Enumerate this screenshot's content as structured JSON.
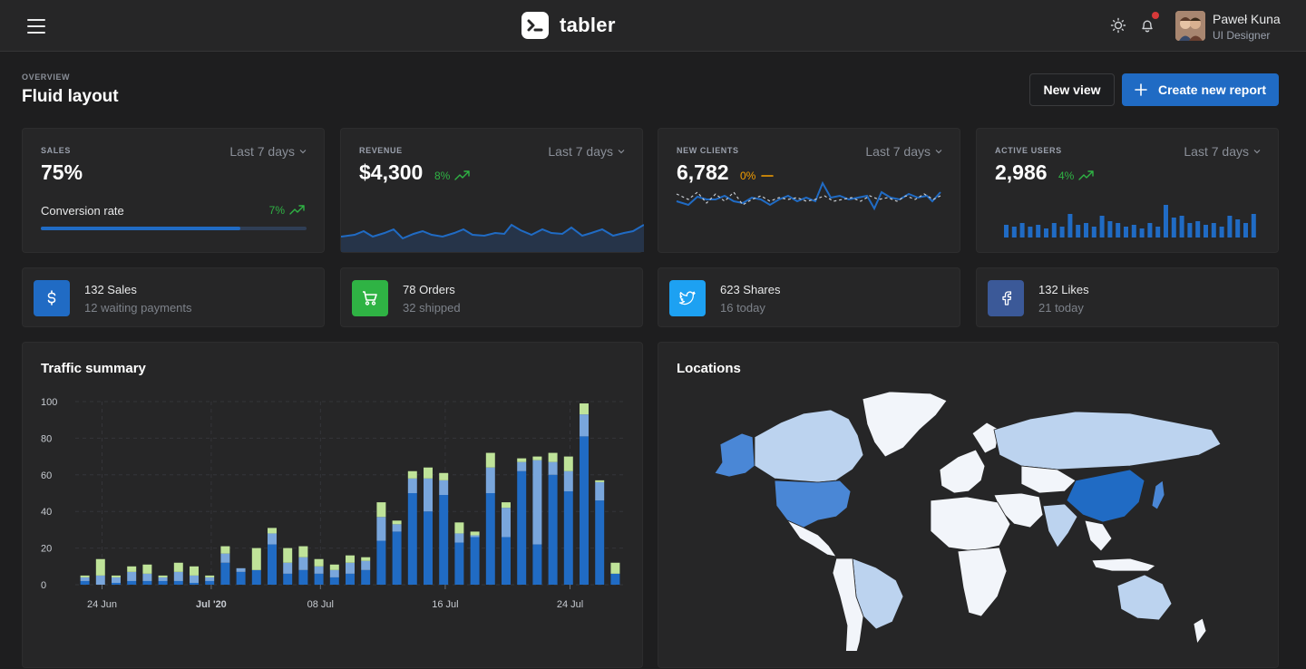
{
  "header": {
    "brand": "tabler",
    "user_name": "Paweł Kuna",
    "user_role": "UI Designer"
  },
  "page": {
    "pretitle": "OVERVIEW",
    "title": "Fluid layout",
    "new_view_label": "New view",
    "create_report_label": "Create new report"
  },
  "stats": [
    {
      "subheader": "SALES",
      "range": "Last 7 days",
      "value": "75%",
      "footer_label": "Conversion rate",
      "trend": "7%",
      "progress": 0.75
    },
    {
      "subheader": "REVENUE",
      "range": "Last 7 days",
      "value": "$4,300",
      "trend": "8%"
    },
    {
      "subheader": "NEW CLIENTS",
      "range": "Last 7 days",
      "value": "6,782",
      "trend": "0%"
    },
    {
      "subheader": "ACTIVE USERS",
      "range": "Last 7 days",
      "value": "2,986",
      "trend": "4%"
    }
  ],
  "mini_cards": [
    {
      "icon": "dollar-icon",
      "color": "#206bc4",
      "title": "132 Sales",
      "subtitle": "12 waiting payments"
    },
    {
      "icon": "cart-icon",
      "color": "#2fb344",
      "title": "78 Orders",
      "subtitle": "32 shipped"
    },
    {
      "icon": "twitter-icon",
      "color": "#1da1f2",
      "title": "623 Shares",
      "subtitle": "16 today"
    },
    {
      "icon": "facebook-icon",
      "color": "#3b5998",
      "title": "132 Likes",
      "subtitle": "21 today"
    }
  ],
  "traffic": {
    "title": "Traffic summary"
  },
  "locations": {
    "title": "Locations"
  },
  "colors": {
    "primary": "#206bc4",
    "success": "#2fb344",
    "warning": "#f59f00",
    "danger": "#d63939"
  },
  "chart_data": {
    "type": "bar",
    "title": "Traffic summary",
    "stacked": true,
    "ylim": [
      0,
      100
    ],
    "yticks": [
      0,
      20,
      40,
      60,
      80,
      100
    ],
    "xtick_labels": [
      "24 Jun",
      "Jul '20",
      "08 Jul",
      "16 Jul",
      "24 Jul"
    ],
    "series": [
      {
        "color": "#206bc4",
        "values": [
          2,
          0,
          1,
          2,
          2,
          2,
          2,
          1,
          2,
          12,
          7,
          8,
          22,
          6,
          8,
          6,
          4,
          6,
          8,
          24,
          29,
          50,
          40,
          49,
          23,
          26,
          50,
          26,
          62,
          22,
          60,
          51,
          81,
          46,
          6
        ]
      },
      {
        "color": "#79a6dc",
        "values": [
          2,
          5,
          3,
          5,
          4,
          2,
          5,
          4,
          2,
          5,
          2,
          0,
          6,
          6,
          7,
          4,
          4,
          6,
          5,
          13,
          4,
          8,
          18,
          8,
          5,
          1,
          14,
          16,
          5,
          46,
          7,
          11,
          12,
          10,
          0
        ]
      },
      {
        "color": "#bfe399",
        "values": [
          1,
          9,
          1,
          3,
          5,
          1,
          5,
          5,
          1,
          4,
          0,
          12,
          3,
          8,
          6,
          4,
          3,
          4,
          2,
          8,
          2,
          4,
          6,
          4,
          6,
          2,
          8,
          3,
          2,
          2,
          5,
          8,
          6,
          1,
          6
        ]
      }
    ]
  }
}
